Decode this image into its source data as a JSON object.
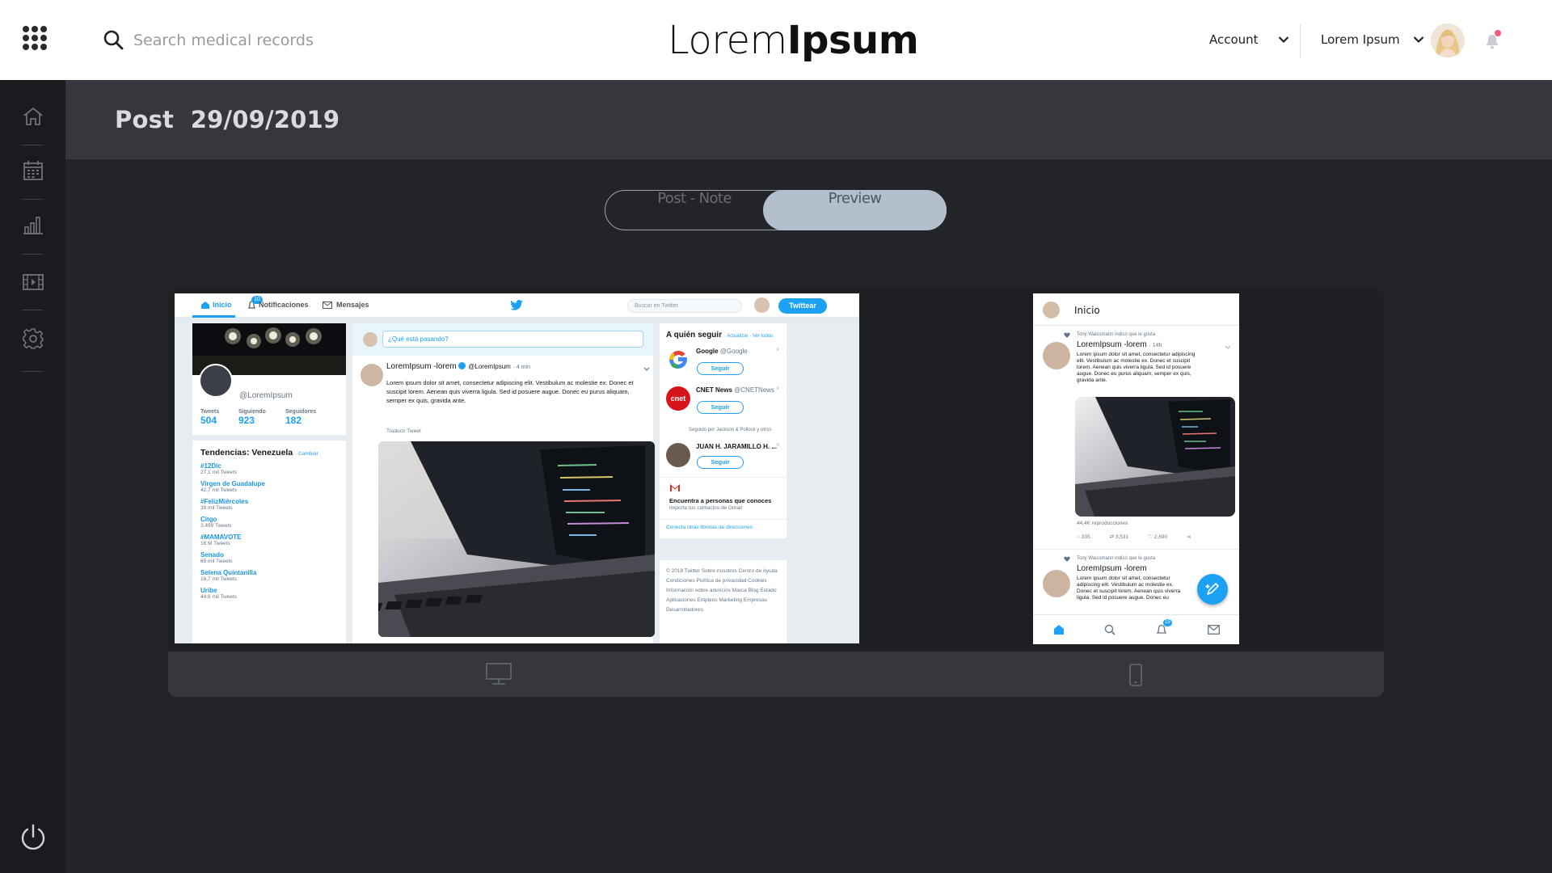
{
  "header": {
    "search_placeholder": "Search medical records",
    "logo_light": "Lorem",
    "logo_bold": "Ipsum",
    "account_label": "Account",
    "user_label": "Lorem Ipsum"
  },
  "sidebar": {
    "items": [
      {
        "icon": "home-icon"
      },
      {
        "icon": "calendar-icon"
      },
      {
        "icon": "bar-chart-icon"
      },
      {
        "icon": "film-icon"
      },
      {
        "icon": "settings-icon"
      }
    ],
    "footer_icon": "power-icon"
  },
  "page": {
    "title": "Post  29/09/2019"
  },
  "toggle": {
    "options": [
      "Post - Note",
      "Preview"
    ],
    "selected": "Preview"
  },
  "preview_devices": [
    "desktop-icon",
    "mobile-icon"
  ],
  "desktop_preview": {
    "nav": {
      "home": "Inicio",
      "notifications": "Notificaciones",
      "notifications_badge": "10",
      "messages": "Mensajes",
      "search_placeholder": "Buscar en Twitter",
      "tweet_button": "Twittear"
    },
    "profile": {
      "handle": "@LoremIpsum",
      "stats": [
        {
          "label": "Tweets",
          "value": "504"
        },
        {
          "label": "Siguiendo",
          "value": "923"
        },
        {
          "label": "Seguidores",
          "value": "182"
        }
      ]
    },
    "trends": {
      "title": "Tendencias: Venezuela",
      "change": "· Cambiar",
      "items": [
        {
          "tag": "#12Dic",
          "count": "27,1 mil Tweets"
        },
        {
          "tag": "Virgen de Guadalupe",
          "count": "42,7 mil Tweets"
        },
        {
          "tag": "#FelizMiércoles",
          "count": "39 mil Tweets"
        },
        {
          "tag": "Citgo",
          "count": "3.499 Tweets"
        },
        {
          "tag": "#MAMAVOTE",
          "count": "16 M Tweets"
        },
        {
          "tag": "Senado",
          "count": "65 mil Tweets"
        },
        {
          "tag": "Selena Quintanilla",
          "count": "16,7 mil Tweets"
        },
        {
          "tag": "Uribe",
          "count": "44,6 mil Tweets"
        }
      ]
    },
    "compose_placeholder": "¿Qué está pasando?",
    "tweet": {
      "name": "LoremIpsum -lorem",
      "handle": "@LoremIpsum",
      "time": "· 4 min",
      "text": "Lorem ipsum dolor sit amet, consectetur adipiscing elit. Vestibulum ac molestie ex. Donec et suscipit lorem. Aenean quis viverra ligula. Sed id posuere augue. Donec eu purus aliquam, semper ex quis, gravida ante.",
      "translate": "Traducir Tweet"
    },
    "who_to_follow": {
      "title": "A quién seguir",
      "links": "· Actualizar · Ver todos",
      "follow_label": "Seguir",
      "items": [
        {
          "name": "Google",
          "handle": "@Google"
        },
        {
          "name": "CNET News",
          "handle": "@CNETNews"
        },
        {
          "name": "JUAN H. JARAMILLO H. ...",
          "handle": ""
        }
      ],
      "followed_by": "Seguido por Jackson & Pollock y otros",
      "find_title": "Encuentra a personas que conoces",
      "find_sub": "Importa tus contactos de Gmail",
      "connect": "Conecta otras libretas de direcciones"
    },
    "footer_links": "© 2018 Twitter  Sobre nosotros  Centro de Ayuda  Condiciones  Política de privacidad  Cookies  Información sobre anuncios  Marca  Blog  Estado  Aplicaciones  Empleos  Marketing  Empresas  Desarrolladores"
  },
  "mobile_preview": {
    "title": "Inicio",
    "liked_by": "Tony Waissmann indicó que le gusta",
    "tweet1": {
      "name": "LoremIpsum -lorem",
      "time": "· 14h",
      "text": "Lorem ipsum dolor sit amet, consectetur adipiscing elit. Vestibulum ac molestie ex. Donec et suscipit lorem. Aenean quis viverra ligula. Sed id posuere augue. Donec eu purus aliquam, semper ex quis, gravida ante.",
      "views": "44,4K reproducciones",
      "replies": "335",
      "retweets": "3,531",
      "likes": "2,690"
    },
    "tweet2": {
      "name": "LoremIpsum -lorem",
      "text": "Lorem ipsum dolor sit amet, consectetur adipiscing elit. Vestibulum ac molestie ex. Donec et suscipit lorem. Aenean quis viverra ligula. Sed id posuere augue. Donec eu"
    },
    "notif_badge": "15"
  }
}
